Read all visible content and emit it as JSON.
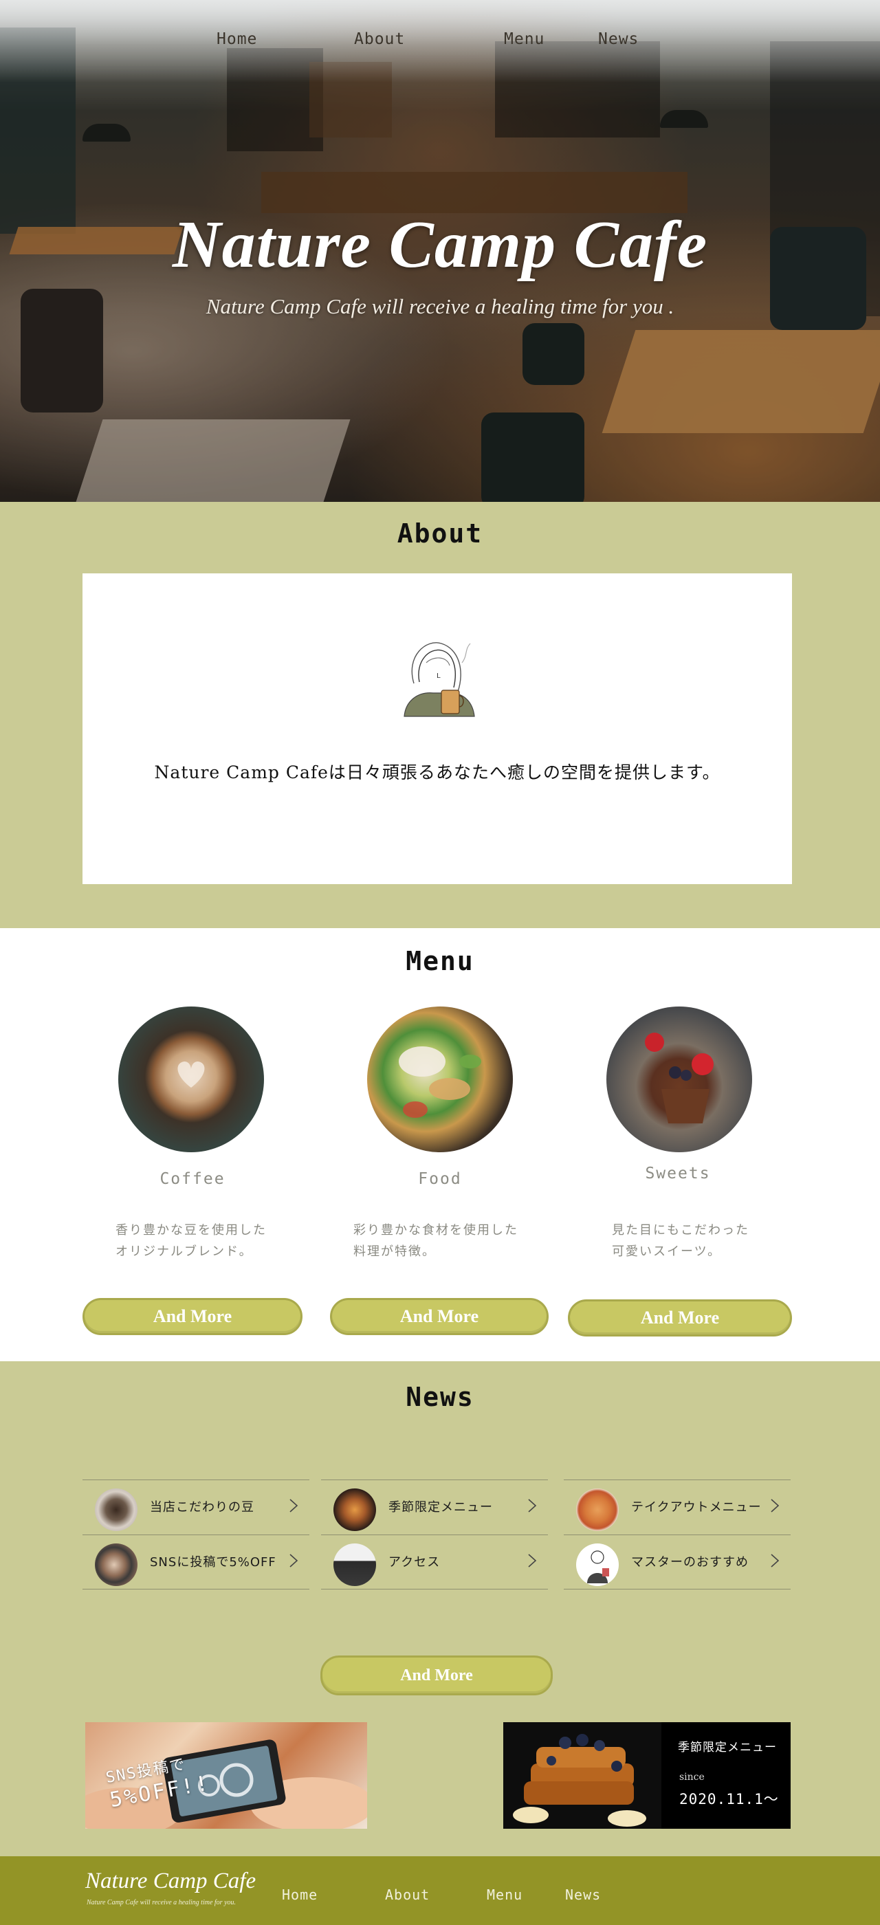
{
  "nav": {
    "items": [
      {
        "label": "Home"
      },
      {
        "label": "About"
      },
      {
        "label": "Menu"
      },
      {
        "label": "News"
      }
    ]
  },
  "hero": {
    "title": "Nature Camp Cafe",
    "subtitle": "Nature Camp Cafe will receive a healing time for you ."
  },
  "about": {
    "heading": "About",
    "text": "Nature Camp Cafeは日々頑張るあなたへ癒しの空間を提供します。"
  },
  "menu": {
    "heading": "Menu",
    "items": [
      {
        "name": "Coffee",
        "desc_line1": "香り豊かな豆を使用した",
        "desc_line2": "オリジナルブレンド。",
        "button": "And More"
      },
      {
        "name": "Food",
        "desc_line1": "彩り豊かな食材を使用した",
        "desc_line2": "料理が特徴。",
        "button": "And More"
      },
      {
        "name": "Sweets",
        "desc_line1": "見た目にもこだわった",
        "desc_line2": "可愛いスイーツ。",
        "button": "And More"
      }
    ]
  },
  "news": {
    "heading": "News",
    "items": [
      {
        "label": "当店こだわりの豆"
      },
      {
        "label": "SNSに投稿で5%OFF"
      },
      {
        "label": "季節限定メニュー"
      },
      {
        "label": "アクセス"
      },
      {
        "label": "テイクアウトメニュー"
      },
      {
        "label": "マスターのおすすめ"
      }
    ],
    "more_button": "And More"
  },
  "banners": {
    "sns": {
      "line1": "SNS投稿で",
      "line2": "5%OFF!!"
    },
    "season": {
      "title": "季節限定メニュー",
      "since": "since",
      "date": "2020.11.1〜"
    }
  },
  "footer": {
    "logo": "Nature Camp Cafe",
    "tagline": "Nature Camp Cafe will receive a healing time for you.",
    "nav": [
      {
        "label": "Home"
      },
      {
        "label": "About"
      },
      {
        "label": "Menu"
      },
      {
        "label": "News"
      }
    ]
  },
  "colors": {
    "section_green": "#cacb95",
    "button_green": "#c8c863",
    "footer_olive": "#939426"
  }
}
